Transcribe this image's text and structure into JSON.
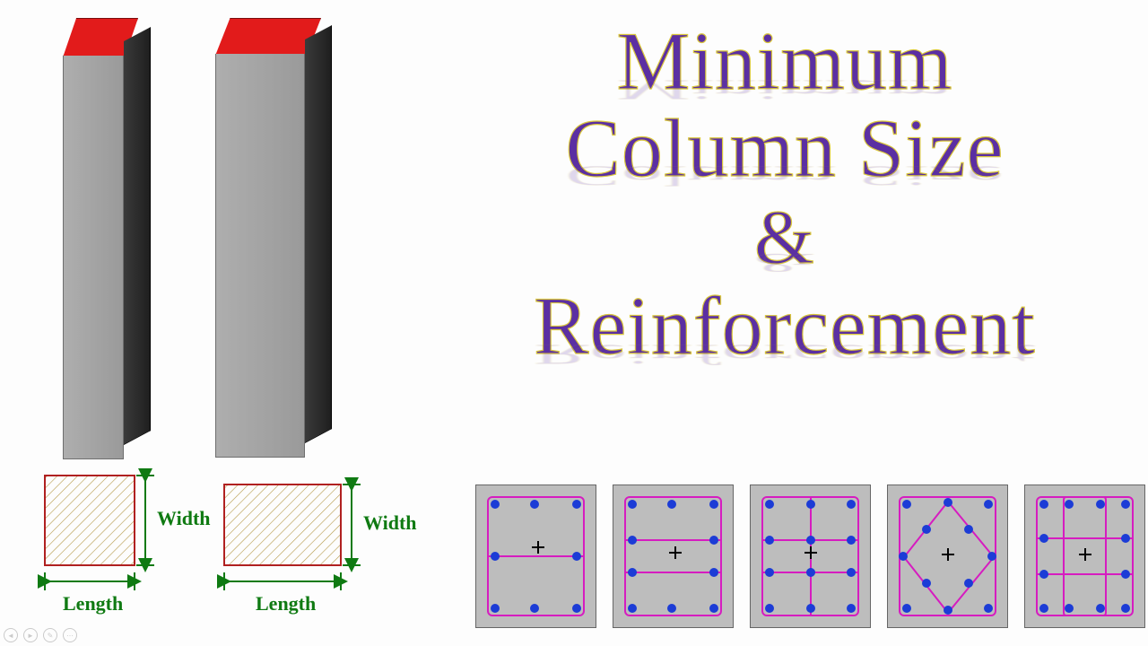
{
  "headline": {
    "l1": "Minimum",
    "l2": "Column Size",
    "l3": "&",
    "l4": "Reinforcement"
  },
  "plan_labels": {
    "width": "Width",
    "length": "Length"
  },
  "columns": {
    "c1": {
      "shape": "square"
    },
    "c2": {
      "shape": "rectangular"
    }
  },
  "sections_count": 5
}
